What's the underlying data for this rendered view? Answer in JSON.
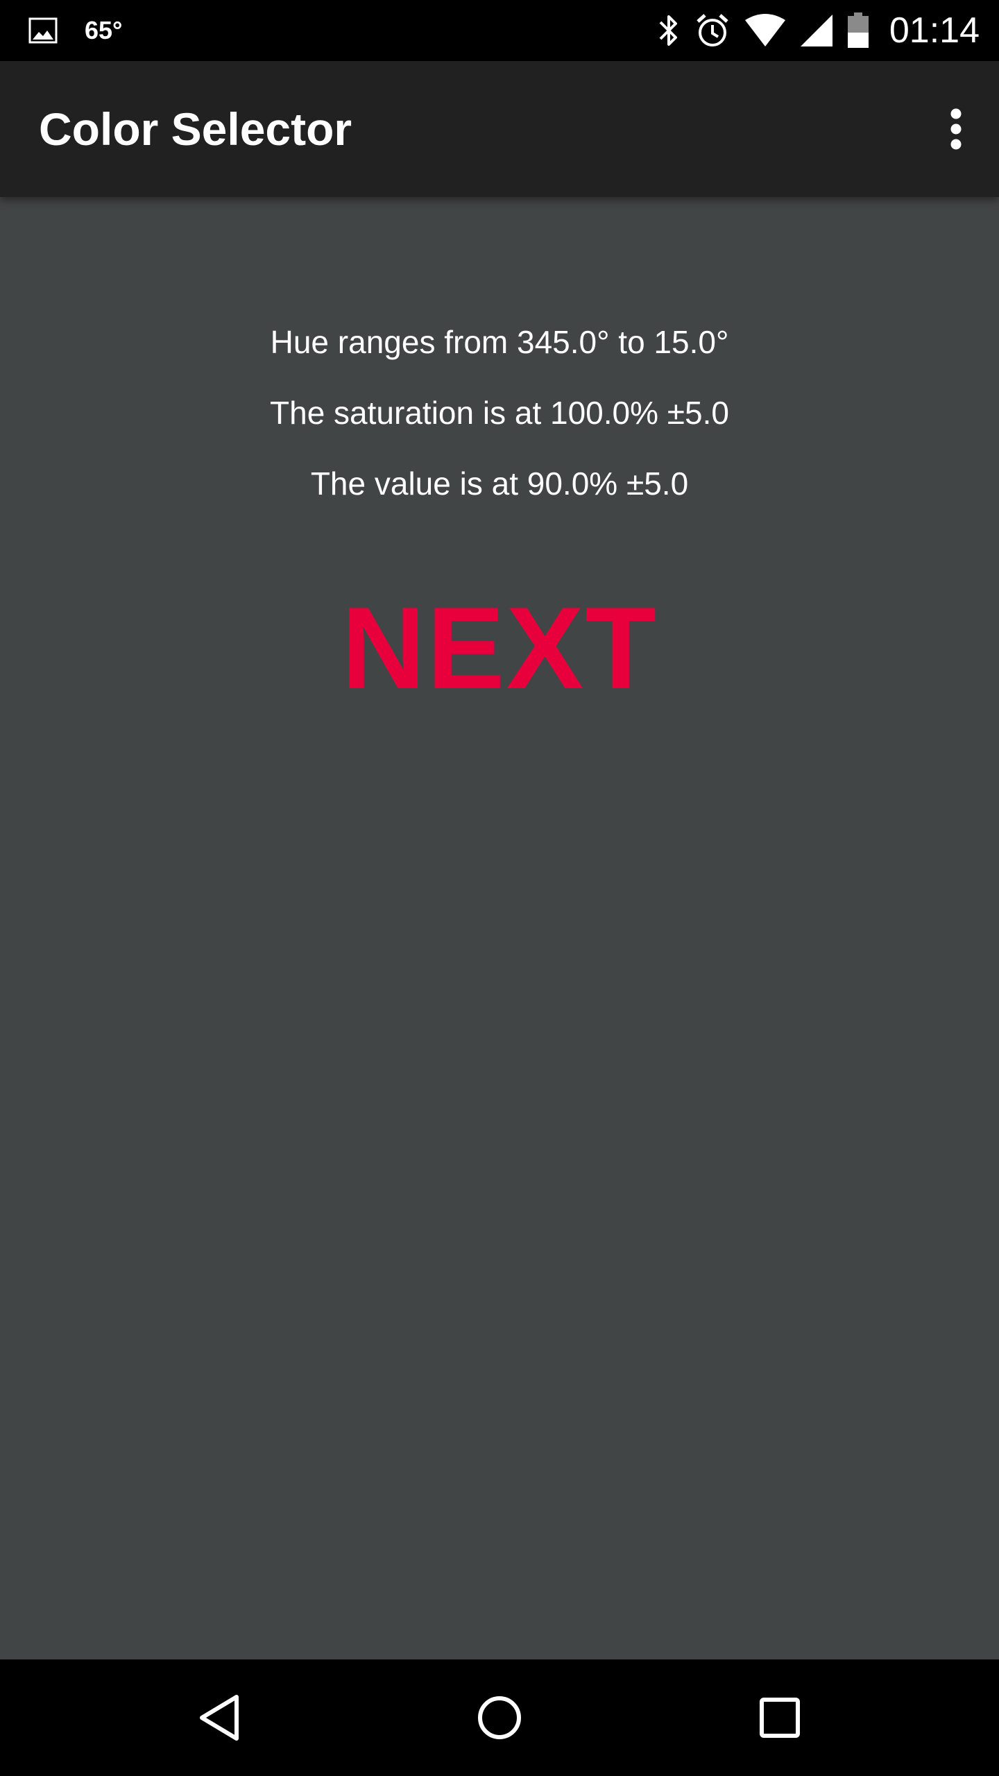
{
  "status_bar": {
    "temperature": "65°",
    "time": "01:14",
    "icons": [
      "image-icon",
      "bluetooth-icon",
      "alarm-icon",
      "wifi-icon",
      "cell-signal-icon",
      "battery-icon"
    ]
  },
  "app_bar": {
    "title": "Color Selector",
    "overflow_icon": "more-vert-icon"
  },
  "main": {
    "hue_text": "Hue ranges from 345.0° to 15.0°",
    "saturation_text": "The saturation is at 100.0% ±5.0",
    "value_text": "The value is at 90.0% ±5.0",
    "next_label": "NEXT",
    "next_color": "#e8003c"
  },
  "nav_bar": {
    "icons": [
      "back-icon",
      "home-icon",
      "recents-icon"
    ]
  },
  "colors": {
    "status_bar_bg": "#000000",
    "app_bar_bg": "#212121",
    "content_bg": "#424545",
    "accent": "#e8003c"
  }
}
